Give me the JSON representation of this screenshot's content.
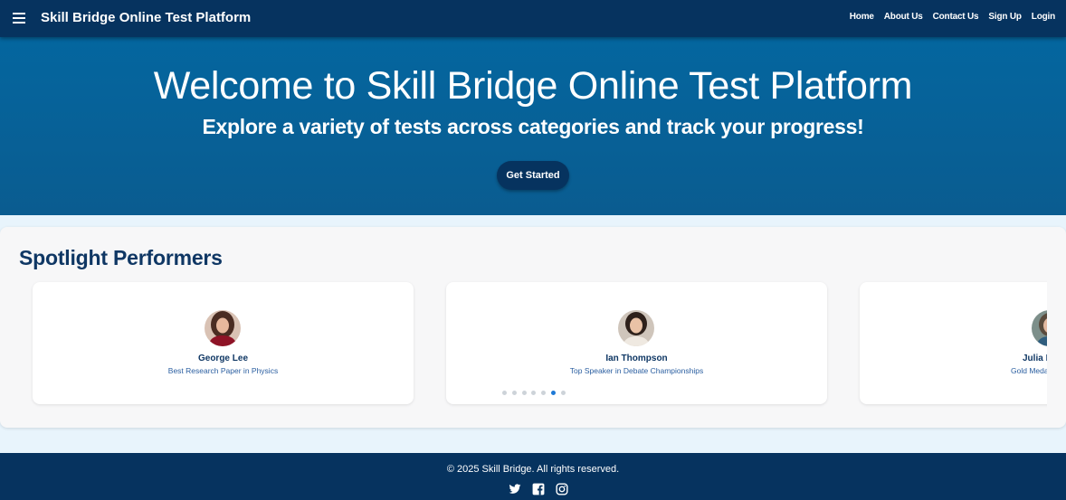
{
  "navbar": {
    "brand": "Skill Bridge Online Test Platform",
    "links": [
      "Home",
      "About Us",
      "Contact Us",
      "Sign Up",
      "Login"
    ]
  },
  "hero": {
    "title": "Welcome to Skill Bridge Online Test Platform",
    "subtitle": "Explore a variety of tests across categories and track your progress!",
    "cta_label": "Get Started"
  },
  "spotlight": {
    "heading": "Spotlight Performers",
    "performers": [
      {
        "name": "George Lee",
        "award": "Best Research Paper in Physics"
      },
      {
        "name": "Ian Thompson",
        "award": "Top Speaker in Debate Championships"
      },
      {
        "name": "Julia M",
        "award": "Gold Meda"
      }
    ],
    "carousel": {
      "dot_count": 7,
      "active_index": 5
    }
  },
  "footer": {
    "copyright": "© 2025 Skill Bridge. All rights reserved.",
    "socials": [
      "twitter-icon",
      "facebook-icon",
      "instagram-icon"
    ]
  },
  "colors": {
    "navbar_bg": "#06335f",
    "hero_bg": "#04669f",
    "page_bg": "#e8f4fc",
    "heading_text": "#0f3764",
    "award_text": "#2a5ea0",
    "dot_active": "#1e79d6"
  }
}
